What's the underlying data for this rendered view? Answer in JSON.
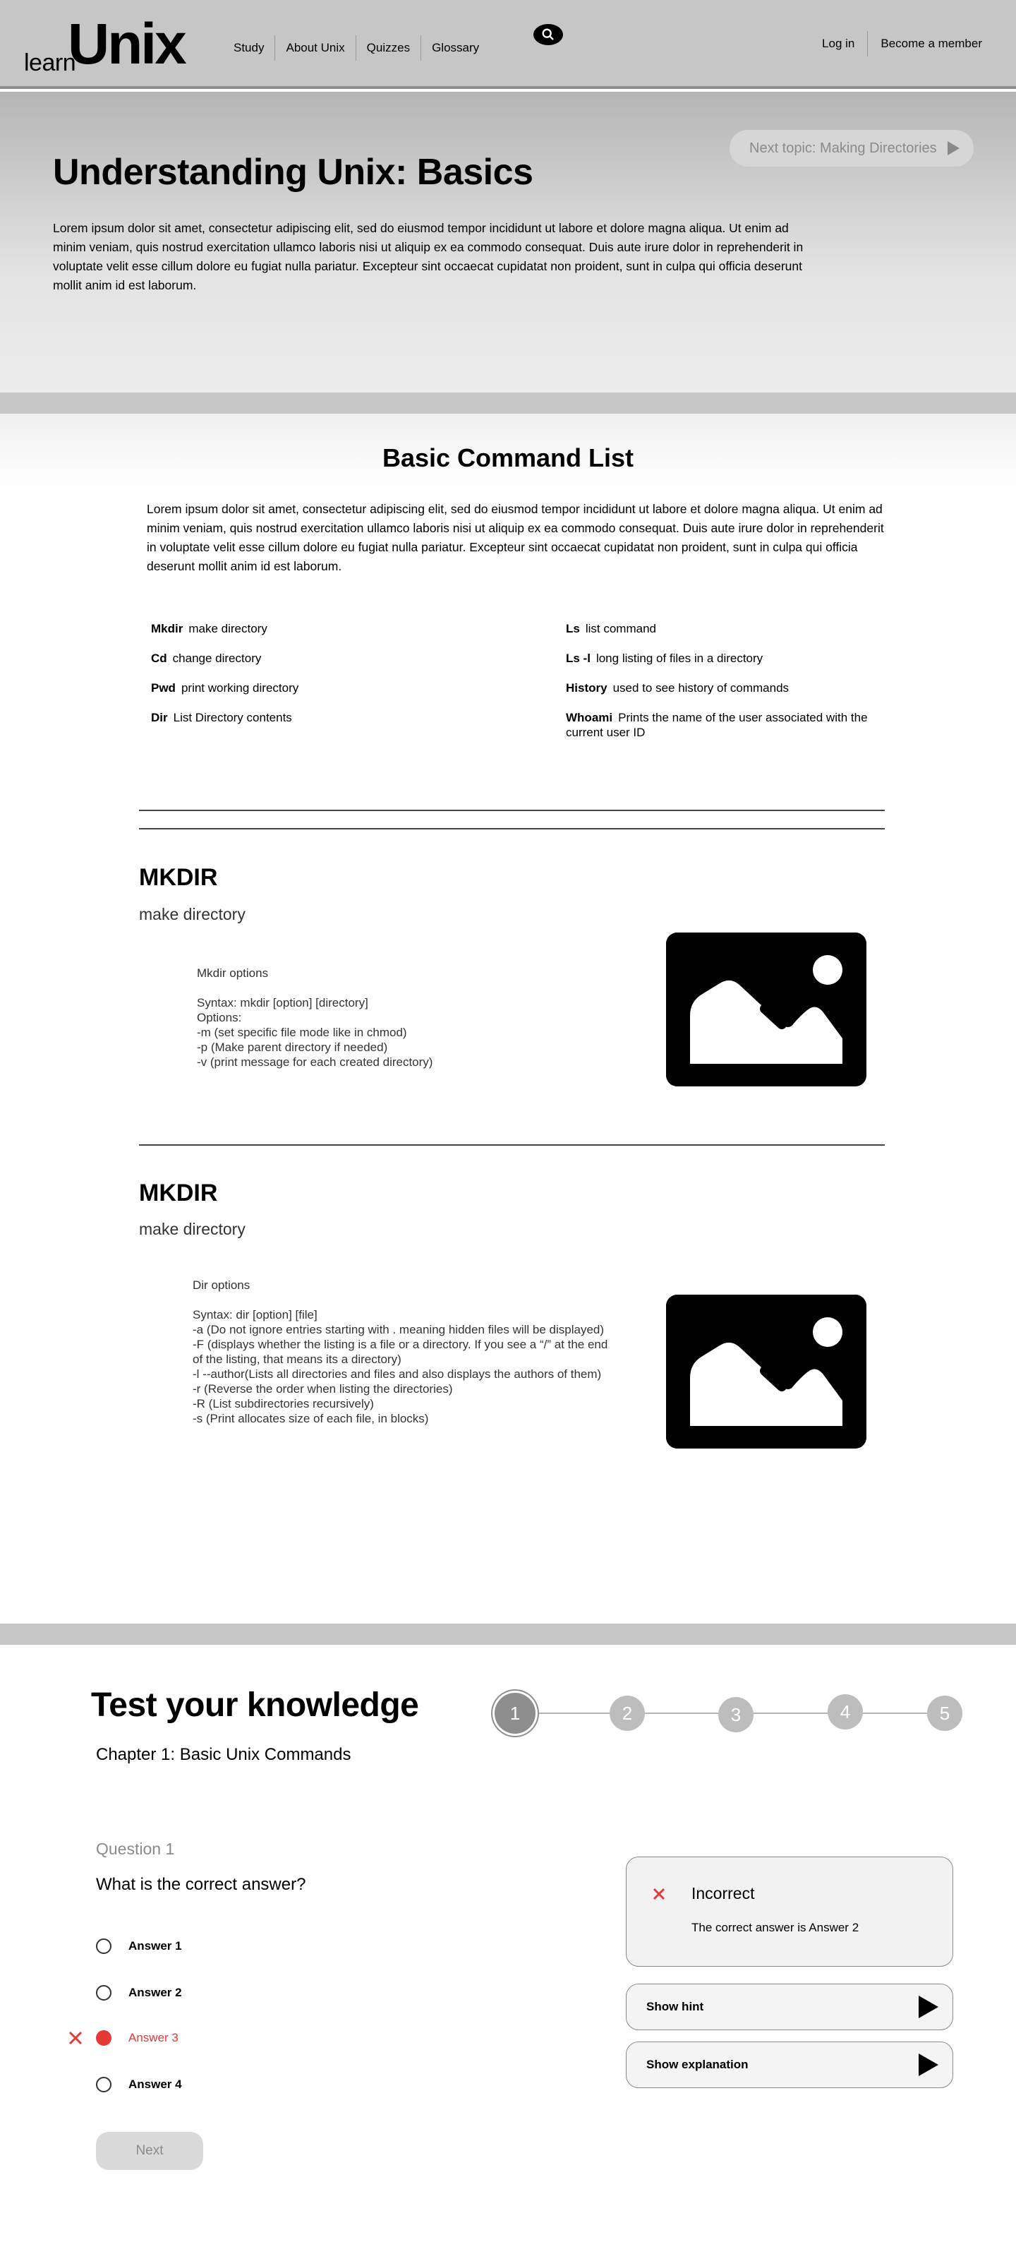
{
  "header": {
    "logo_learn": "learn",
    "logo_unix": "Unix",
    "nav": [
      "Study",
      "About Unix",
      "Quizzes",
      "Glossary"
    ],
    "auth": [
      "Log in",
      "Become a member"
    ],
    "search_icon": "search-icon"
  },
  "hero": {
    "next_topic": "Next topic: Making Directories",
    "title": "Understanding Unix: Basics",
    "body": "Lorem ipsum dolor sit amet, consectetur adipiscing elit, sed do eiusmod tempor incididunt ut labore et dolore magna aliqua. Ut enim ad minim veniam, quis nostrud exercitation ullamco laboris nisi ut aliquip ex ea commodo consequat. Duis aute irure dolor in reprehenderit in voluptate velit esse cillum dolore eu fugiat nulla pariatur. Excepteur sint occaecat cupidatat non proident, sunt in culpa qui officia deserunt mollit anim id est laborum."
  },
  "commands": {
    "title": "Basic Command List",
    "body": "Lorem ipsum dolor sit amet, consectetur adipiscing elit, sed do eiusmod tempor incididunt ut labore et dolore magna aliqua. Ut enim ad minim veniam, quis nostrud exercitation ullamco laboris nisi ut aliquip ex ea commodo consequat. Duis aute irure dolor in reprehenderit in voluptate velit esse cillum dolore eu fugiat nulla pariatur. Excepteur sint occaecat cupidatat non proident, sunt in culpa qui officia deserunt mollit anim id est laborum.",
    "left": [
      {
        "cmd": "Mkdir",
        "desc": "make directory"
      },
      {
        "cmd": "Cd",
        "desc": "change directory"
      },
      {
        "cmd": "Pwd",
        "desc": "print working directory"
      },
      {
        "cmd": "Dir",
        "desc": "List Directory contents"
      }
    ],
    "right": [
      {
        "cmd": "Ls",
        "desc": "list command"
      },
      {
        "cmd": "Ls -l",
        "desc": "long listing of files in a directory"
      },
      {
        "cmd": "History",
        "desc": "used to see history of commands"
      },
      {
        "cmd": "Whoami",
        "desc": "Prints the name of the user associated with the current user ID"
      }
    ]
  },
  "sections": [
    {
      "title": "MKDIR",
      "subtitle": "make directory",
      "options_heading": "Mkdir options",
      "lines": [
        "Syntax: mkdir [option] [directory]",
        "Options:",
        "-m (set specific file mode like in chmod)",
        "-p (Make parent directory if needed)",
        "-v (print message for each created directory)"
      ],
      "image_icon": "image-placeholder-icon"
    },
    {
      "title": "MKDIR",
      "subtitle": "make directory",
      "options_heading": "Dir options",
      "lines": [
        "Syntax: dir [option] [file]",
        "-a (Do not ignore entries starting with . meaning hidden files will be displayed)",
        "-F (displays whether the listing is a file or a directory. If you see a “/” at the end of the listing, that means its a directory)",
        "-l --author(Lists all directories and files and also displays the authors of them)",
        "-r (Reverse the order when listing the directories)",
        "-R (List subdirectories recursively)",
        "-s (Print allocates size of each file, in blocks)"
      ],
      "image_icon": "image-placeholder-icon"
    }
  ],
  "quiz": {
    "title": "Test your knowledge",
    "chapter": "Chapter 1: Basic Unix Commands",
    "steps": [
      "1",
      "2",
      "3",
      "4",
      "5"
    ],
    "active_step": 1,
    "question_label": "Question 1",
    "question": "What is the correct answer?",
    "answers": [
      "Answer 1",
      "Answer 2",
      "Answer 3",
      "Answer 4"
    ],
    "selected_wrong": 3,
    "next": "Next",
    "feedback_title": "Incorrect",
    "feedback_text": "The correct answer is Answer 2",
    "show_hint": "Show hint",
    "show_explanation": "Show explanation",
    "colors": {
      "wrong": "#e53935",
      "step": "#bdbdbd",
      "step_active": "#8e8e8e"
    }
  }
}
